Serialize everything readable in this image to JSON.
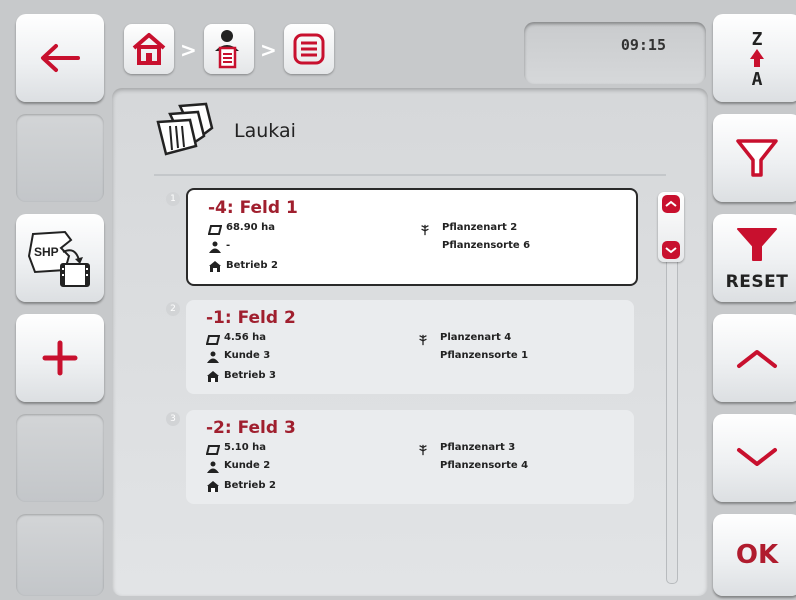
{
  "clock": "09:15",
  "page": {
    "title": "Laukai"
  },
  "fields": [
    {
      "index": "1",
      "name": "-4: Feld 1",
      "area": "68.90 ha",
      "customer": "-",
      "farm": "Betrieb 2",
      "plant_type": "Pflanzenart 2",
      "plant_variety": "Pflanzensorte 6"
    },
    {
      "index": "2",
      "name": "-1: Feld 2",
      "area": "4.56 ha",
      "customer": "Kunde 3",
      "farm": "Betrieb 3",
      "plant_type": "Planzenart 4",
      "plant_variety": "Pflanzensorte 1"
    },
    {
      "index": "3",
      "name": "-2: Feld 3",
      "area": "5.10 ha",
      "customer": "Kunde 2",
      "farm": "Betrieb 2",
      "plant_type": "Pflanzenart 3",
      "plant_variety": "Pflanzensorte 4"
    }
  ],
  "breadcrumb": {
    "separator": ">"
  },
  "buttons": {
    "shp_label": "SHP",
    "reset_label": "RESET",
    "ok_label": "OK",
    "sort_top": "Z",
    "sort_bottom": "A"
  },
  "colors": {
    "accent": "#c8102e",
    "title_red": "#a01f2e",
    "background": "#c7c9cb"
  }
}
